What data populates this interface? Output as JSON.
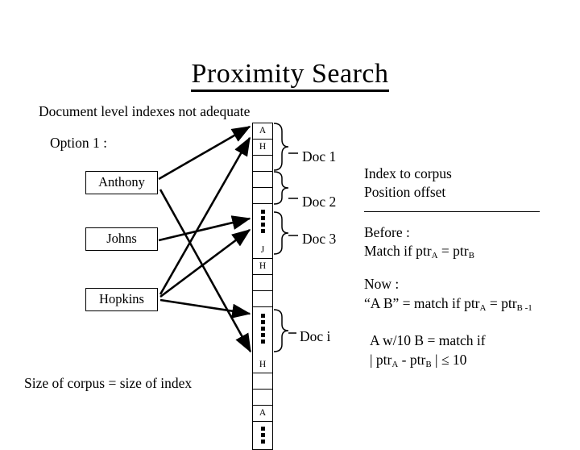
{
  "slide": {
    "title": "Proximity Search",
    "subtitle": "Document level indexes not adequate",
    "option_label": "Option 1 :",
    "footer": "Size of corpus = size of index"
  },
  "terms": [
    {
      "label": "Anthony"
    },
    {
      "label": "Johns"
    },
    {
      "label": "Hopkins"
    }
  ],
  "index_strip": {
    "cells": [
      {
        "text": "A"
      },
      {
        "text": "H"
      },
      {
        "text": ""
      },
      {
        "text": ""
      },
      {
        "text": ""
      },
      {
        "text": "⋮",
        "kind": "dots"
      },
      {
        "text": "J"
      },
      {
        "text": "H"
      },
      {
        "text": ""
      },
      {
        "text": ""
      },
      {
        "text": "⋮",
        "kind": "dots"
      },
      {
        "text": "H"
      },
      {
        "text": ""
      },
      {
        "text": ""
      },
      {
        "text": "A"
      },
      {
        "text": "⋮",
        "kind": "dots"
      }
    ]
  },
  "doc_labels": [
    {
      "label": "Doc 1"
    },
    {
      "label": "Doc 2"
    },
    {
      "label": "Doc 3"
    },
    {
      "label": "Doc i"
    }
  ],
  "right_panel": {
    "heading_line1": "Index to corpus",
    "heading_line2": "Position offset",
    "before_label": "Before :",
    "before_line": "Match if ptr",
    "before_sub_a": "A",
    "before_eq": " = ptr",
    "before_sub_b": "B",
    "now_label": "Now :",
    "now_line": "“A B” = match if ptr",
    "now_sub_a": "A",
    "now_eq": " = ptr",
    "now_sub_b": "B -1",
    "window_line1": "A w/10 B = match if",
    "window_prefix": "| ptr",
    "window_sub_a": "A",
    "window_mid": " - ptr",
    "window_sub_b": "B",
    "window_suffix": " | ≤ 10"
  },
  "colors": {
    "ink": "#000000",
    "background": "#ffffff"
  }
}
